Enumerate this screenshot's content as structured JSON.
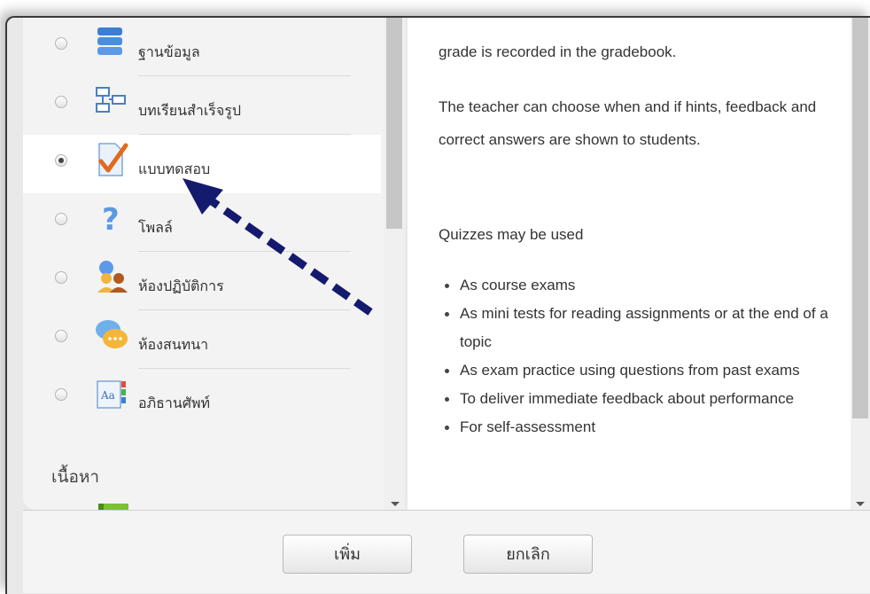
{
  "modules": [
    {
      "label": "ฐานข้อมูล",
      "icon": "database-icon",
      "selected": false
    },
    {
      "label": "บทเรียนสำเร็จรูป",
      "icon": "lesson-icon",
      "selected": false
    },
    {
      "label": "แบบทดสอบ",
      "icon": "quiz-icon",
      "selected": true
    },
    {
      "label": "โพลล์",
      "icon": "choice-icon",
      "selected": false
    },
    {
      "label": "ห้องปฏิบัติการ",
      "icon": "workshop-icon",
      "selected": false
    },
    {
      "label": "ห้องสนทนา",
      "icon": "chat-icon",
      "selected": false
    },
    {
      "label": "อภิธานศัพท์",
      "icon": "glossary-icon",
      "selected": false
    }
  ],
  "section_heading": "เนื้อหา",
  "description": {
    "p1": "grade is recorded in the gradebook.",
    "p2": "The teacher can choose when and if hints, feedback and correct answers are shown to students.",
    "p3": "Quizzes may be used",
    "bullets": [
      "As course exams",
      "As mini tests for reading assignments or at the end of a topic",
      "As exam practice using questions from past exams",
      "To deliver immediate feedback about performance",
      "For self-assessment"
    ]
  },
  "footer": {
    "add_label": "เพิ่ม",
    "cancel_label": "ยกเลิก"
  },
  "colors": {
    "annotation_arrow": "#141a6e",
    "quiz_check": "#e06a1e"
  }
}
